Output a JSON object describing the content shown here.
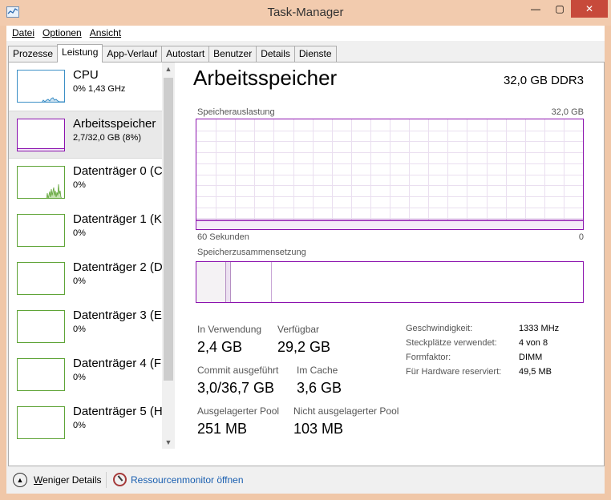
{
  "window": {
    "title": "Task-Manager",
    "minimize": "—",
    "maximize": "▢",
    "close": "✕"
  },
  "menu": [
    "Datei",
    "Optionen",
    "Ansicht"
  ],
  "tabs": [
    "Prozesse",
    "Leistung",
    "App-Verlauf",
    "Autostart",
    "Benutzer",
    "Details",
    "Dienste"
  ],
  "active_tab": "Leistung",
  "sidebar": {
    "items": [
      {
        "name": "CPU",
        "value": "0% 1,43 GHz",
        "icon": "cpu-graph-icon",
        "color": "#3c8fc6"
      },
      {
        "name": "Arbeitsspeicher",
        "value": "2,7/32,0 GB (8%)",
        "icon": "memory-graph-icon",
        "color": "#8b12ae",
        "selected": true
      },
      {
        "name": "Datenträger 0 (C",
        "value": "0%",
        "icon": "disk-graph-icon",
        "color": "#5fa437"
      },
      {
        "name": "Datenträger 1 (K",
        "value": "0%",
        "icon": "disk-graph-icon",
        "color": "#5fa437"
      },
      {
        "name": "Datenträger 2 (D",
        "value": "0%",
        "icon": "disk-graph-icon",
        "color": "#5fa437"
      },
      {
        "name": "Datenträger 3 (E",
        "value": "0%",
        "icon": "disk-graph-icon",
        "color": "#5fa437"
      },
      {
        "name": "Datenträger 4 (F",
        "value": "0%",
        "icon": "disk-graph-icon",
        "color": "#5fa437"
      },
      {
        "name": "Datenträger 5 (H",
        "value": "0%",
        "icon": "disk-graph-icon",
        "color": "#5fa437"
      }
    ]
  },
  "main": {
    "title": "Arbeitsspeicher",
    "subtitle": "32,0 GB DDR3",
    "graph_label": "Speicherauslastung",
    "graph_max": "32,0 GB",
    "graph_time": "60 Sekunden",
    "graph_min": "0",
    "composition_label": "Speicherzusammensetzung",
    "stats": {
      "in_use_label": "In Verwendung",
      "in_use": "2,4 GB",
      "available_label": "Verfügbar",
      "available": "29,2 GB",
      "committed_label": "Commit ausgeführt",
      "committed": "3,0/36,7 GB",
      "cached_label": "Im Cache",
      "cached": "3,6 GB",
      "paged_label": "Ausgelagerter Pool",
      "paged": "251 MB",
      "nonpaged_label": "Nicht ausgelagerter Pool",
      "nonpaged": "103 MB"
    },
    "properties": [
      {
        "label": "Geschwindigkeit:",
        "value": "1333 MHz"
      },
      {
        "label": "Steckplätze verwendet:",
        "value": "4 von 8"
      },
      {
        "label": "Formfaktor:",
        "value": "DIMM"
      },
      {
        "label": "Für Hardware reserviert:",
        "value": "49,5 MB"
      }
    ],
    "memory_usage_fraction": 0.08
  },
  "footer": {
    "fewer_details": "Weniger Details",
    "fewer_details_key": "W",
    "resource_monitor": "Ressourcenmonitor öffnen"
  }
}
